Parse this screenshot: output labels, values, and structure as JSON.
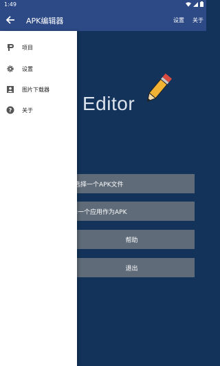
{
  "status_bar": {
    "time": "1:49"
  },
  "app_bar": {
    "title": "APK编辑器",
    "actions": {
      "settings": "设置",
      "about": "关于"
    }
  },
  "main": {
    "logo_text": "Editor",
    "buttons": {
      "choose_apk": "选择一个APK文件",
      "choose_app": "择一个应用作为APK",
      "help": "帮助",
      "exit": "退出"
    }
  },
  "drawer": {
    "items": [
      {
        "label": "项目",
        "icon": "project-icon"
      },
      {
        "label": "设置",
        "icon": "gear-icon"
      },
      {
        "label": "图片下载器",
        "icon": "image-icon"
      },
      {
        "label": "关于",
        "icon": "help-icon"
      }
    ]
  },
  "colors": {
    "app_bar": "#2d4a87",
    "background": "#13335a",
    "button": "#5f6b78",
    "drawer": "#ffffff"
  }
}
